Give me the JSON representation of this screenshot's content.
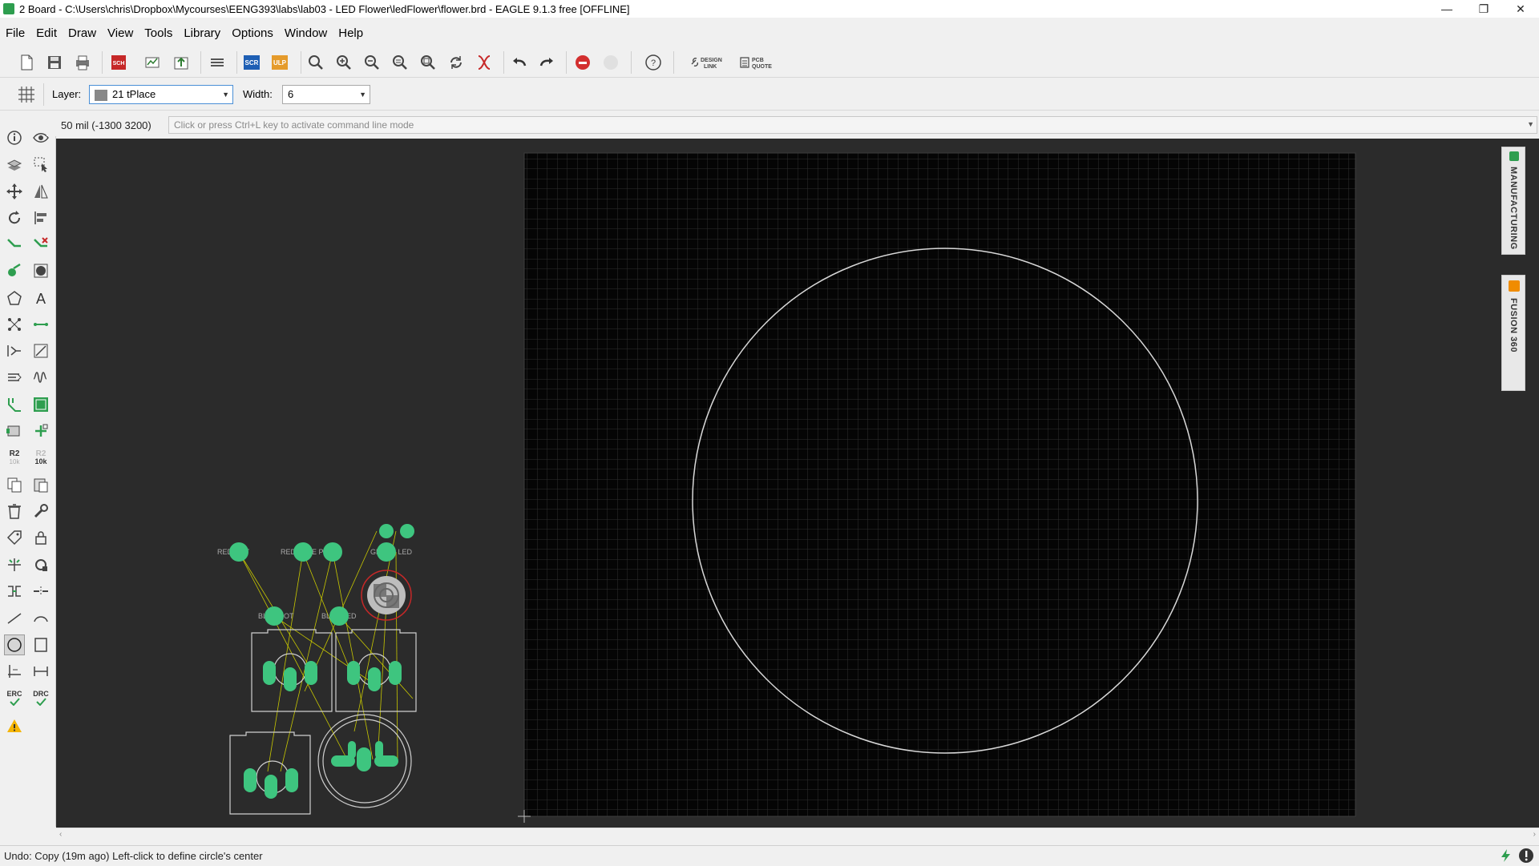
{
  "window": {
    "title": "2 Board - C:\\Users\\chris\\Dropbox\\Mycourses\\EENG393\\labs\\lab03 - LED Flower\\ledFlower\\flower.brd - EAGLE 9.1.3 free [OFFLINE]",
    "controls": [
      "—",
      "❐",
      "✕"
    ]
  },
  "menu": [
    "File",
    "Edit",
    "Draw",
    "View",
    "Tools",
    "Library",
    "Options",
    "Window",
    "Help"
  ],
  "toolbar": {
    "scr_label": "SCR",
    "ulp_label": "ULP",
    "design_link_line1": "DESIGN",
    "design_link_line2": "LINK",
    "pcb_quote_line1": "PCB",
    "pcb_quote_line2": "QUOTE",
    "help_icon": "?"
  },
  "params": {
    "layer_label": "Layer:",
    "layer_value": "21 tPlace",
    "width_label": "Width:",
    "width_value": "6"
  },
  "commandbar": {
    "coords": "50 mil (-1300 3200)",
    "placeholder": "Click or press Ctrl+L key to activate command line mode"
  },
  "lefttools": {
    "r2_label": "R2",
    "r2_sub": "10k",
    "r2b_sub": "10k",
    "erc_label": "ERC",
    "drc_label": "DRC"
  },
  "right_panel": {
    "manufacturing": "MANUFACTURING",
    "fusion": "FUSION 360"
  },
  "parts": {
    "red_pot_a": "RED POT",
    "red_pot_b": "RED BLUE POT",
    "green_led": "GREEN LED",
    "blue_pot": "BLUE POT",
    "blue_led": "BLUE LED"
  },
  "status": {
    "message": "Undo: Copy (19m ago) Left-click to define circle's center"
  },
  "colors": {
    "canvas_bg": "#2b2b2b",
    "board_bg": "#050505",
    "grid": "#3a3a3a",
    "pad": "#3ec57f",
    "airwire": "#c8c800",
    "silk": "#cfcfcf"
  }
}
